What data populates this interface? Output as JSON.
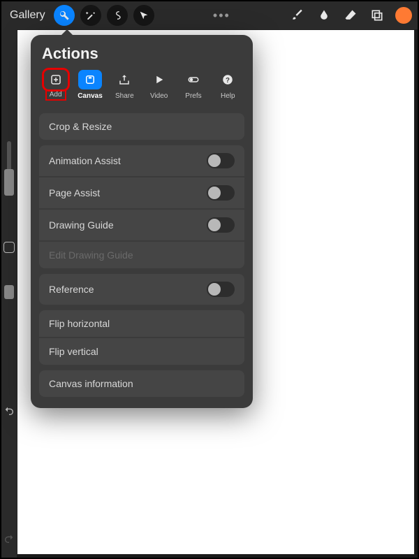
{
  "topbar": {
    "gallery": "Gallery"
  },
  "panel": {
    "title": "Actions",
    "tabs": {
      "add": "Add",
      "canvas": "Canvas",
      "share": "Share",
      "video": "Video",
      "prefs": "Prefs",
      "help": "Help"
    },
    "items": {
      "crop_resize": "Crop & Resize",
      "animation_assist": "Animation Assist",
      "page_assist": "Page Assist",
      "drawing_guide": "Drawing Guide",
      "edit_drawing_guide": "Edit Drawing Guide",
      "reference": "Reference",
      "flip_horizontal": "Flip horizontal",
      "flip_vertical": "Flip vertical",
      "canvas_information": "Canvas information"
    },
    "toggles": {
      "animation_assist": false,
      "page_assist": false,
      "drawing_guide": false,
      "reference": false
    }
  },
  "colors": {
    "accent": "#0a84ff",
    "swatch": "#ff7a33",
    "highlight": "#e60000"
  }
}
